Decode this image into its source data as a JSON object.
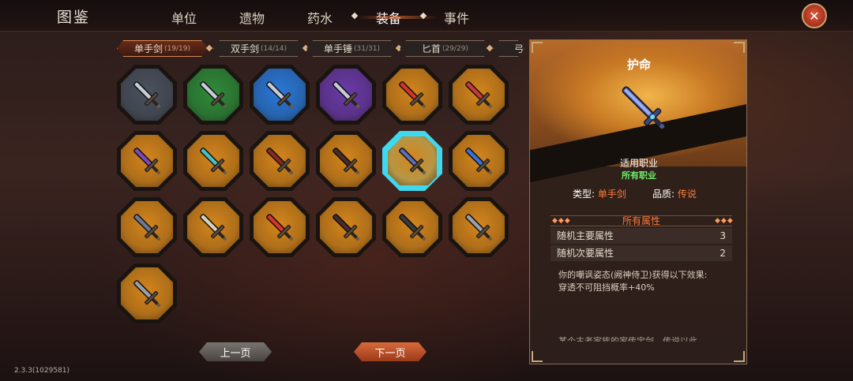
{
  "header": {
    "title": "图鉴",
    "tabs": [
      {
        "label": "单位"
      },
      {
        "label": "遗物"
      },
      {
        "label": "药水"
      },
      {
        "label": "装备"
      },
      {
        "label": "事件"
      }
    ],
    "active_tab": "装备"
  },
  "sub_tabs": [
    {
      "label": "单手剑",
      "count": "(19/19)"
    },
    {
      "label": "双手剑",
      "count": "(14/14)"
    },
    {
      "label": "单手锤",
      "count": "(31/31)"
    },
    {
      "label": "匕首",
      "count": "(29/29)"
    },
    {
      "label": "弓",
      "count": ""
    }
  ],
  "active_sub_tab": "单手剑",
  "grid": {
    "items": [
      {
        "rarity": "gray",
        "color": "#4a5260",
        "icon": "sword-icon"
      },
      {
        "rarity": "green",
        "color": "#2f8a3a",
        "icon": "sword-icon"
      },
      {
        "rarity": "blue",
        "color": "#2a78d8",
        "icon": "sword-icon"
      },
      {
        "rarity": "purple",
        "color": "#6a3aa8",
        "icon": "sword-icon"
      },
      {
        "rarity": "orange",
        "color": "#d4851c",
        "icon": "red-sword-icon"
      },
      {
        "rarity": "orange",
        "color": "#d4851c",
        "icon": "cleaver-sword-icon"
      },
      {
        "rarity": "orange",
        "color": "#d4851c",
        "icon": "purple-rapier-icon"
      },
      {
        "rarity": "orange",
        "color": "#d4851c",
        "icon": "teal-rapier-icon"
      },
      {
        "rarity": "orange",
        "color": "#d4851c",
        "icon": "curved-blade-icon"
      },
      {
        "rarity": "orange",
        "color": "#d4851c",
        "icon": "dark-sword-icon"
      },
      {
        "rarity": "orange",
        "color": "#d4851c",
        "icon": "guardian-sword-icon",
        "selected": true
      },
      {
        "rarity": "orange",
        "color": "#d4851c",
        "icon": "blue-sword-icon"
      },
      {
        "rarity": "orange",
        "color": "#d4851c",
        "icon": "broad-sword-icon"
      },
      {
        "rarity": "orange",
        "color": "#d4851c",
        "icon": "scimitar-icon"
      },
      {
        "rarity": "orange",
        "color": "#d4851c",
        "icon": "red-sword-icon"
      },
      {
        "rarity": "orange",
        "color": "#d4851c",
        "icon": "dark-sword-icon"
      },
      {
        "rarity": "orange",
        "color": "#d4851c",
        "icon": "falchion-icon"
      },
      {
        "rarity": "orange",
        "color": "#d4851c",
        "icon": "spear-sword-icon"
      },
      {
        "rarity": "orange",
        "color": "#d4851c",
        "icon": "spear-sword-icon"
      }
    ]
  },
  "pagination": {
    "prev_label": "上一页",
    "next_label": "下一页"
  },
  "version": "2.3.3(1029581)",
  "detail": {
    "name": "护命",
    "job_label": "适用职业",
    "job_value": "所有职业",
    "type_label": "类型: ",
    "type_value": "单手剑",
    "quality_label": "品质: ",
    "quality_value": "传说",
    "attrs_header": "所有属性",
    "attrs": [
      {
        "label": "随机主要属性",
        "value": "3"
      },
      {
        "label": "随机次要属性",
        "value": "2"
      }
    ],
    "desc_lines": [
      "你的嘲讽姿态(阙神侍卫)获得以下效果:",
      "穿透不可阻挡概率+40%"
    ],
    "desc_cut": "某个古老家族的家传宝剑，传说以此"
  },
  "colors": {
    "accent": "#ff7a3a",
    "job_green": "#6cf06a",
    "selected_border": "#3ed8ef"
  }
}
